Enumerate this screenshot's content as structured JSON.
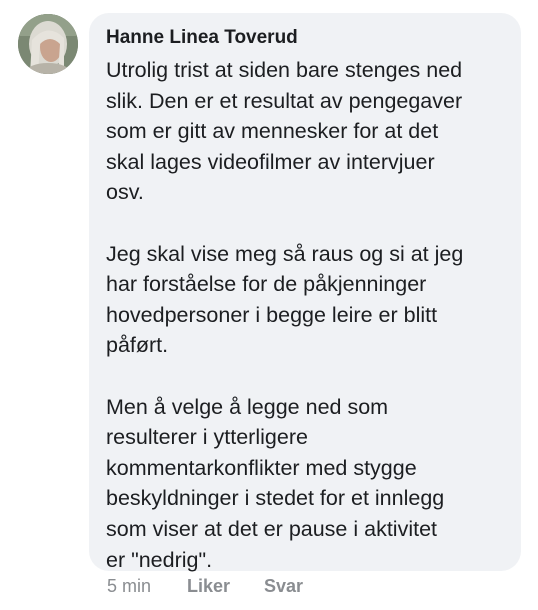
{
  "comment": {
    "author": "Hanne Linea Toverud",
    "avatar_icon": "profile-photo",
    "paragraphs": [
      "Utrolig trist at siden bare stenges ned\nslik.  Den er et resultat av pengegaver\nsom er gitt av mennesker for at det\nskal lages videofilmer av intervjuer\nosv.",
      "Jeg skal vise meg så raus og si at jeg\nhar forståelse for de påkjenninger\nhovedpersoner i begge leire er blitt\npåført.",
      "Men å velge å legge ned som\nresulterer i ytterligere\nkommentarkonflikter med stygge\nbeskyldninger i stedet for et innlegg\nsom viser at det er pause i aktivitet\ner \"nedrig\"."
    ],
    "timestamp": "5 min",
    "like_label": "Liker",
    "reply_label": "Svar"
  },
  "colors": {
    "bubble_bg": "#f0f2f5",
    "text": "#1c1e21",
    "meta_text": "#8a8d91"
  }
}
